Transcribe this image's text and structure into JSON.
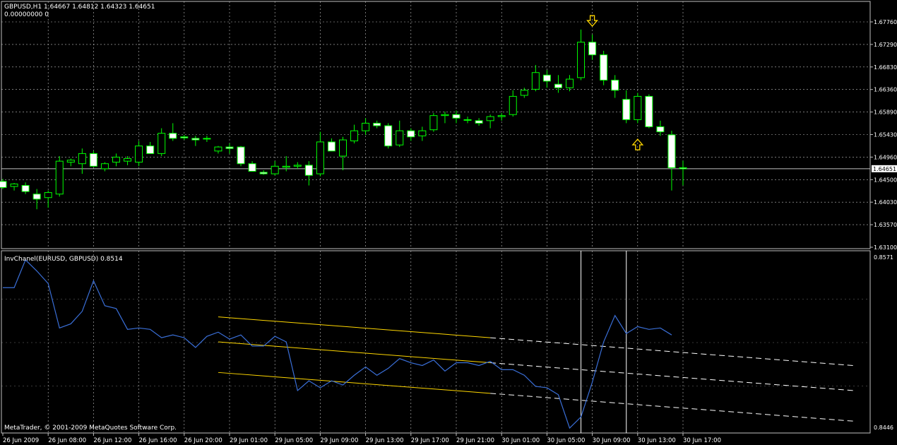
{
  "main_panel": {
    "header_line1": "GBPUSD,H1  1.64667 1.64812 1.64323 1.64651",
    "header_line2": "0.00000000  0",
    "price_axis_labels": [
      "1.67760",
      "1.67290",
      "1.66830",
      "1.66360",
      "1.65890",
      "1.65430",
      "1.64960",
      "1.64500",
      "1.64030",
      "1.63570",
      "1.63100"
    ],
    "current_price_label": "1.64651",
    "current_price": 1.64651
  },
  "indicator_panel": {
    "header": "InvChanel(EURUSD, GBPUSD) 0.8514",
    "axis_top_label": "0.8571",
    "axis_bottom_label": "0.8446",
    "copyright": "MetaTrader, © 2001-2009 MetaQuotes Software Corp."
  },
  "time_axis_labels": [
    "26 Jun 2009",
    "26 Jun 08:00",
    "26 Jun 12:00",
    "26 Jun 16:00",
    "26 Jun 20:00",
    "29 Jun 01:00",
    "29 Jun 05:00",
    "29 Jun 09:00",
    "29 Jun 13:00",
    "29 Jun 17:00",
    "29 Jun 21:00",
    "30 Jun 01:00",
    "30 Jun 05:00",
    "30 Jun 09:00",
    "30 Jun 13:00",
    "30 Jun 17:00"
  ],
  "colors": {
    "background": "#000000",
    "grid": "#c0c0c0",
    "axis_text": "#ffffff",
    "bull_body": "#000000",
    "bear_body": "#ffffff",
    "candle_wick": "#00ff00",
    "indicator_line": "#3a6fd8",
    "channel_solid": "#ffd700",
    "channel_dashed": "#ffffff",
    "arrow": "#ffd700",
    "vertical_marker": "#ffffff"
  },
  "chart_data": [
    {
      "type": "candlestick",
      "title": "GBPUSD,H1",
      "ylim": [
        1.631,
        1.6776
      ],
      "candles": [
        {
          "o": 1.644,
          "h": 1.6445,
          "l": 1.6425,
          "c": 1.6428
        },
        {
          "o": 1.643,
          "h": 1.6437,
          "l": 1.6422,
          "c": 1.6435
        },
        {
          "o": 1.6432,
          "h": 1.6438,
          "l": 1.6415,
          "c": 1.642
        },
        {
          "o": 1.6415,
          "h": 1.6425,
          "l": 1.6385,
          "c": 1.6405
        },
        {
          "o": 1.6408,
          "h": 1.6422,
          "l": 1.6388,
          "c": 1.6418
        },
        {
          "o": 1.6415,
          "h": 1.649,
          "l": 1.641,
          "c": 1.648
        },
        {
          "o": 1.6478,
          "h": 1.6485,
          "l": 1.647,
          "c": 1.6482
        },
        {
          "o": 1.6475,
          "h": 1.6505,
          "l": 1.6455,
          "c": 1.6495
        },
        {
          "o": 1.6495,
          "h": 1.65,
          "l": 1.6468,
          "c": 1.647
        },
        {
          "o": 1.6465,
          "h": 1.6478,
          "l": 1.646,
          "c": 1.6475
        },
        {
          "o": 1.6478,
          "h": 1.6495,
          "l": 1.647,
          "c": 1.6488
        },
        {
          "o": 1.648,
          "h": 1.649,
          "l": 1.6472,
          "c": 1.6485
        },
        {
          "o": 1.6478,
          "h": 1.652,
          "l": 1.647,
          "c": 1.651
        },
        {
          "o": 1.651,
          "h": 1.6518,
          "l": 1.6495,
          "c": 1.6495
        },
        {
          "o": 1.6495,
          "h": 1.6545,
          "l": 1.649,
          "c": 1.6535
        },
        {
          "o": 1.6535,
          "h": 1.6555,
          "l": 1.652,
          "c": 1.6525
        },
        {
          "o": 1.6528,
          "h": 1.6532,
          "l": 1.6522,
          "c": 1.6526
        },
        {
          "o": 1.6525,
          "h": 1.653,
          "l": 1.651,
          "c": 1.6522
        },
        {
          "o": 1.6525,
          "h": 1.653,
          "l": 1.6518,
          "c": 1.6524
        },
        {
          "o": 1.65,
          "h": 1.651,
          "l": 1.6495,
          "c": 1.6508
        },
        {
          "o": 1.6508,
          "h": 1.6515,
          "l": 1.6495,
          "c": 1.6505
        },
        {
          "o": 1.6508,
          "h": 1.651,
          "l": 1.647,
          "c": 1.6475
        },
        {
          "o": 1.6475,
          "h": 1.648,
          "l": 1.646,
          "c": 1.646
        },
        {
          "o": 1.6458,
          "h": 1.6462,
          "l": 1.6453,
          "c": 1.6455
        },
        {
          "o": 1.6455,
          "h": 1.648,
          "l": 1.6452,
          "c": 1.647
        },
        {
          "o": 1.6468,
          "h": 1.649,
          "l": 1.646,
          "c": 1.647
        },
        {
          "o": 1.647,
          "h": 1.6478,
          "l": 1.6465,
          "c": 1.6472
        },
        {
          "o": 1.6472,
          "h": 1.648,
          "l": 1.6432,
          "c": 1.6452
        },
        {
          "o": 1.6455,
          "h": 1.6538,
          "l": 1.645,
          "c": 1.6518
        },
        {
          "o": 1.6518,
          "h": 1.6525,
          "l": 1.65,
          "c": 1.65
        },
        {
          "o": 1.649,
          "h": 1.6528,
          "l": 1.6462,
          "c": 1.6522
        },
        {
          "o": 1.652,
          "h": 1.6552,
          "l": 1.6515,
          "c": 1.654
        },
        {
          "o": 1.654,
          "h": 1.6565,
          "l": 1.6532,
          "c": 1.6555
        },
        {
          "o": 1.6555,
          "h": 1.656,
          "l": 1.6545,
          "c": 1.655
        },
        {
          "o": 1.655,
          "h": 1.6555,
          "l": 1.6505,
          "c": 1.651
        },
        {
          "o": 1.6512,
          "h": 1.656,
          "l": 1.6508,
          "c": 1.654
        },
        {
          "o": 1.654,
          "h": 1.6545,
          "l": 1.652,
          "c": 1.6528
        },
        {
          "o": 1.653,
          "h": 1.6548,
          "l": 1.652,
          "c": 1.654
        },
        {
          "o": 1.6542,
          "h": 1.6575,
          "l": 1.6538,
          "c": 1.657
        },
        {
          "o": 1.657,
          "h": 1.6578,
          "l": 1.6555,
          "c": 1.6572
        },
        {
          "o": 1.6572,
          "h": 1.658,
          "l": 1.6555,
          "c": 1.6565
        },
        {
          "o": 1.6562,
          "h": 1.6568,
          "l": 1.6555,
          "c": 1.6562
        },
        {
          "o": 1.656,
          "h": 1.6565,
          "l": 1.655,
          "c": 1.6555
        },
        {
          "o": 1.656,
          "h": 1.6572,
          "l": 1.6545,
          "c": 1.6568
        },
        {
          "o": 1.6568,
          "h": 1.6575,
          "l": 1.656,
          "c": 1.657
        },
        {
          "o": 1.6572,
          "h": 1.662,
          "l": 1.6568,
          "c": 1.6608
        },
        {
          "o": 1.661,
          "h": 1.6625,
          "l": 1.6605,
          "c": 1.662
        },
        {
          "o": 1.6622,
          "h": 1.667,
          "l": 1.6618,
          "c": 1.6655
        },
        {
          "o": 1.665,
          "h": 1.666,
          "l": 1.6625,
          "c": 1.6638
        },
        {
          "o": 1.6632,
          "h": 1.665,
          "l": 1.6615,
          "c": 1.6625
        },
        {
          "o": 1.6625,
          "h": 1.665,
          "l": 1.6618,
          "c": 1.6642
        },
        {
          "o": 1.6645,
          "h": 1.674,
          "l": 1.664,
          "c": 1.6715
        },
        {
          "o": 1.6715,
          "h": 1.673,
          "l": 1.668,
          "c": 1.669
        },
        {
          "o": 1.669,
          "h": 1.6698,
          "l": 1.663,
          "c": 1.664
        },
        {
          "o": 1.664,
          "h": 1.665,
          "l": 1.6605,
          "c": 1.662
        },
        {
          "o": 1.6602,
          "h": 1.662,
          "l": 1.6555,
          "c": 1.6562
        },
        {
          "o": 1.6562,
          "h": 1.6615,
          "l": 1.6555,
          "c": 1.6608
        },
        {
          "o": 1.6608,
          "h": 1.6612,
          "l": 1.6545,
          "c": 1.6548
        },
        {
          "o": 1.6548,
          "h": 1.656,
          "l": 1.653,
          "c": 1.6538
        },
        {
          "o": 1.6532,
          "h": 1.654,
          "l": 1.6422,
          "c": 1.6467
        },
        {
          "o": 1.6467,
          "h": 1.6481,
          "l": 1.6432,
          "c": 1.6465
        }
      ],
      "annotations": [
        {
          "type": "arrow_down",
          "candle_index": 52,
          "price": 1.6755
        },
        {
          "type": "arrow_up",
          "candle_index": 56,
          "price": 1.6515
        }
      ]
    },
    {
      "type": "line",
      "title": "InvChanel(EURUSD, GBPUSD) 0.8514",
      "ylim": [
        0.8446,
        0.8571
      ],
      "series": [
        {
          "values": [
            0.8548,
            0.8548,
            0.8568,
            0.856,
            0.8551,
            0.8519,
            0.8522,
            0.8531,
            0.8553,
            0.8535,
            0.8533,
            0.8518,
            0.8519,
            0.8518,
            0.8512,
            0.8514,
            0.8512,
            0.8505,
            0.8513,
            0.8516,
            0.8511,
            0.8514,
            0.8506,
            0.8506,
            0.8513,
            0.8509,
            0.8474,
            0.8481,
            0.8476,
            0.8481,
            0.8478,
            0.8485,
            0.8491,
            0.8485,
            0.849,
            0.8497,
            0.8494,
            0.8492,
            0.8496,
            0.8488,
            0.8494,
            0.8494,
            0.8492,
            0.8495,
            0.8489,
            0.8489,
            0.8485,
            0.8477,
            0.8476,
            0.8471,
            0.8447,
            0.8455,
            0.848,
            0.8509,
            0.8528,
            0.8515,
            0.852,
            0.8518,
            0.8519,
            0.8514
          ]
        }
      ],
      "channels": [
        {
          "style": "solid",
          "start_index": 19,
          "end_index": 43,
          "start_value": 0.8527,
          "end_value": 0.8512
        },
        {
          "style": "solid",
          "start_index": 19,
          "end_index": 43,
          "start_value": 0.8509,
          "end_value": 0.8494
        },
        {
          "style": "solid",
          "start_index": 19,
          "end_index": 43,
          "start_value": 0.8487,
          "end_value": 0.8472
        },
        {
          "style": "dashed",
          "start_index": 43,
          "end_index": 75,
          "start_value": 0.8512,
          "end_value": 0.8492
        },
        {
          "style": "dashed",
          "start_index": 43,
          "end_index": 75,
          "start_value": 0.8494,
          "end_value": 0.8474
        },
        {
          "style": "dashed",
          "start_index": 43,
          "end_index": 75,
          "start_value": 0.8472,
          "end_value": 0.8452
        }
      ],
      "vertical_markers": [
        51,
        55
      ]
    }
  ]
}
